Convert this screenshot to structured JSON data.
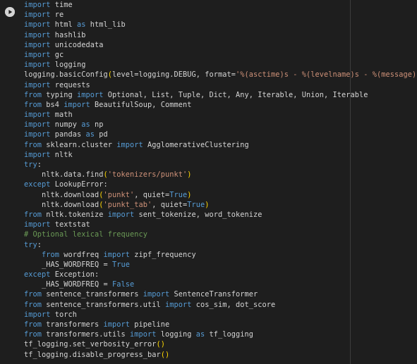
{
  "cell": {
    "run_icon": "play-circle-icon",
    "lines": [
      [
        {
          "t": "import",
          "c": "kw"
        },
        {
          "t": " time",
          "c": "pl"
        }
      ],
      [
        {
          "t": "import",
          "c": "kw"
        },
        {
          "t": " re",
          "c": "pl"
        }
      ],
      [
        {
          "t": "import",
          "c": "kw"
        },
        {
          "t": " html ",
          "c": "pl"
        },
        {
          "t": "as",
          "c": "kw"
        },
        {
          "t": " html_lib",
          "c": "pl"
        }
      ],
      [
        {
          "t": "import",
          "c": "kw"
        },
        {
          "t": " hashlib",
          "c": "pl"
        }
      ],
      [
        {
          "t": "import",
          "c": "kw"
        },
        {
          "t": " unicodedata",
          "c": "pl"
        }
      ],
      [
        {
          "t": "import",
          "c": "kw"
        },
        {
          "t": " gc",
          "c": "pl"
        }
      ],
      [
        {
          "t": "import",
          "c": "kw"
        },
        {
          "t": " logging",
          "c": "pl"
        }
      ],
      [
        {
          "t": "logging.basicConfig",
          "c": "pl"
        },
        {
          "t": "(",
          "c": "br1"
        },
        {
          "t": "level=logging.DEBUG, format=",
          "c": "pl"
        },
        {
          "t": "'%(asctime)s - %(levelname)s - %(message)s'",
          "c": "str"
        },
        {
          "t": ")",
          "c": "br1"
        }
      ],
      [
        {
          "t": "import",
          "c": "kw"
        },
        {
          "t": " requests",
          "c": "pl"
        }
      ],
      [
        {
          "t": "from",
          "c": "kw"
        },
        {
          "t": " typing ",
          "c": "pl"
        },
        {
          "t": "import",
          "c": "kw"
        },
        {
          "t": " Optional, List, Tuple, Dict, Any, Iterable, Union, Iterable",
          "c": "pl"
        }
      ],
      [
        {
          "t": "from",
          "c": "kw"
        },
        {
          "t": " bs4 ",
          "c": "pl"
        },
        {
          "t": "import",
          "c": "kw"
        },
        {
          "t": " BeautifulSoup, Comment",
          "c": "pl"
        }
      ],
      [
        {
          "t": "import",
          "c": "kw"
        },
        {
          "t": " math",
          "c": "pl"
        }
      ],
      [
        {
          "t": "import",
          "c": "kw"
        },
        {
          "t": " numpy ",
          "c": "pl"
        },
        {
          "t": "as",
          "c": "kw"
        },
        {
          "t": " np",
          "c": "pl"
        }
      ],
      [
        {
          "t": "import",
          "c": "kw"
        },
        {
          "t": " pandas ",
          "c": "pl"
        },
        {
          "t": "as",
          "c": "kw"
        },
        {
          "t": " pd",
          "c": "pl"
        }
      ],
      [
        {
          "t": "from",
          "c": "kw"
        },
        {
          "t": " sklearn.cluster ",
          "c": "pl"
        },
        {
          "t": "import",
          "c": "kw"
        },
        {
          "t": " AgglomerativeClustering",
          "c": "pl"
        }
      ],
      [
        {
          "t": "import",
          "c": "kw"
        },
        {
          "t": " nltk",
          "c": "pl"
        }
      ],
      [
        {
          "t": "try",
          "c": "kw"
        },
        {
          "t": ":",
          "c": "pl"
        }
      ],
      [
        {
          "t": "    nltk.data.find",
          "c": "pl"
        },
        {
          "t": "(",
          "c": "br1"
        },
        {
          "t": "'tokenizers/punkt'",
          "c": "str"
        },
        {
          "t": ")",
          "c": "br1"
        }
      ],
      [
        {
          "t": "except",
          "c": "kw"
        },
        {
          "t": " LookupError:",
          "c": "pl"
        }
      ],
      [
        {
          "t": "    nltk.download",
          "c": "pl"
        },
        {
          "t": "(",
          "c": "br1"
        },
        {
          "t": "'punkt'",
          "c": "str"
        },
        {
          "t": ", quiet=",
          "c": "pl"
        },
        {
          "t": "True",
          "c": "cn"
        },
        {
          "t": ")",
          "c": "br1"
        }
      ],
      [
        {
          "t": "    nltk.download",
          "c": "pl"
        },
        {
          "t": "(",
          "c": "br1"
        },
        {
          "t": "'punkt_tab'",
          "c": "str"
        },
        {
          "t": ", quiet=",
          "c": "pl"
        },
        {
          "t": "True",
          "c": "cn"
        },
        {
          "t": ")",
          "c": "br1"
        }
      ],
      [
        {
          "t": "from",
          "c": "kw"
        },
        {
          "t": " nltk.tokenize ",
          "c": "pl"
        },
        {
          "t": "import",
          "c": "kw"
        },
        {
          "t": " sent_tokenize, word_tokenize",
          "c": "pl"
        }
      ],
      [
        {
          "t": "import",
          "c": "kw"
        },
        {
          "t": " textstat",
          "c": "pl"
        }
      ],
      [
        {
          "t": "# Optional lexical frequency",
          "c": "cm"
        }
      ],
      [
        {
          "t": "try",
          "c": "kw"
        },
        {
          "t": ":",
          "c": "pl"
        }
      ],
      [
        {
          "t": "    ",
          "c": "pl"
        },
        {
          "t": "from",
          "c": "kw"
        },
        {
          "t": " wordfreq ",
          "c": "pl"
        },
        {
          "t": "import",
          "c": "kw"
        },
        {
          "t": " zipf_frequency",
          "c": "pl"
        }
      ],
      [
        {
          "t": "    _HAS_WORDFREQ = ",
          "c": "pl"
        },
        {
          "t": "True",
          "c": "cn"
        }
      ],
      [
        {
          "t": "except",
          "c": "kw"
        },
        {
          "t": " Exception:",
          "c": "pl"
        }
      ],
      [
        {
          "t": "    _HAS_WORDFREQ = ",
          "c": "pl"
        },
        {
          "t": "False",
          "c": "cn"
        }
      ],
      [
        {
          "t": "from",
          "c": "kw"
        },
        {
          "t": " sentence_transformers ",
          "c": "pl"
        },
        {
          "t": "import",
          "c": "kw"
        },
        {
          "t": " SentenceTransformer",
          "c": "pl"
        }
      ],
      [
        {
          "t": "from",
          "c": "kw"
        },
        {
          "t": " sentence_transformers.util ",
          "c": "pl"
        },
        {
          "t": "import",
          "c": "kw"
        },
        {
          "t": " cos_sim, dot_score",
          "c": "pl"
        }
      ],
      [
        {
          "t": "import",
          "c": "kw"
        },
        {
          "t": " torch",
          "c": "pl"
        }
      ],
      [
        {
          "t": "from",
          "c": "kw"
        },
        {
          "t": " transformers ",
          "c": "pl"
        },
        {
          "t": "import",
          "c": "kw"
        },
        {
          "t": " pipeline",
          "c": "pl"
        }
      ],
      [
        {
          "t": "from",
          "c": "kw"
        },
        {
          "t": " transformers.utils ",
          "c": "pl"
        },
        {
          "t": "import",
          "c": "kw"
        },
        {
          "t": " logging ",
          "c": "pl"
        },
        {
          "t": "as",
          "c": "kw"
        },
        {
          "t": " tf_logging",
          "c": "pl"
        }
      ],
      [
        {
          "t": "tf_logging.set_verbosity_error",
          "c": "pl"
        },
        {
          "t": "()",
          "c": "br1"
        }
      ],
      [
        {
          "t": "tf_logging.disable_progress_bar",
          "c": "pl"
        },
        {
          "t": "()",
          "c": "br1"
        }
      ]
    ]
  },
  "colors": {
    "background": "#1e1e1e",
    "keyword": "#569cd6",
    "string": "#ce9178",
    "comment": "#6a9955",
    "bracket": "#ffd700",
    "text": "#d4d4d4"
  }
}
